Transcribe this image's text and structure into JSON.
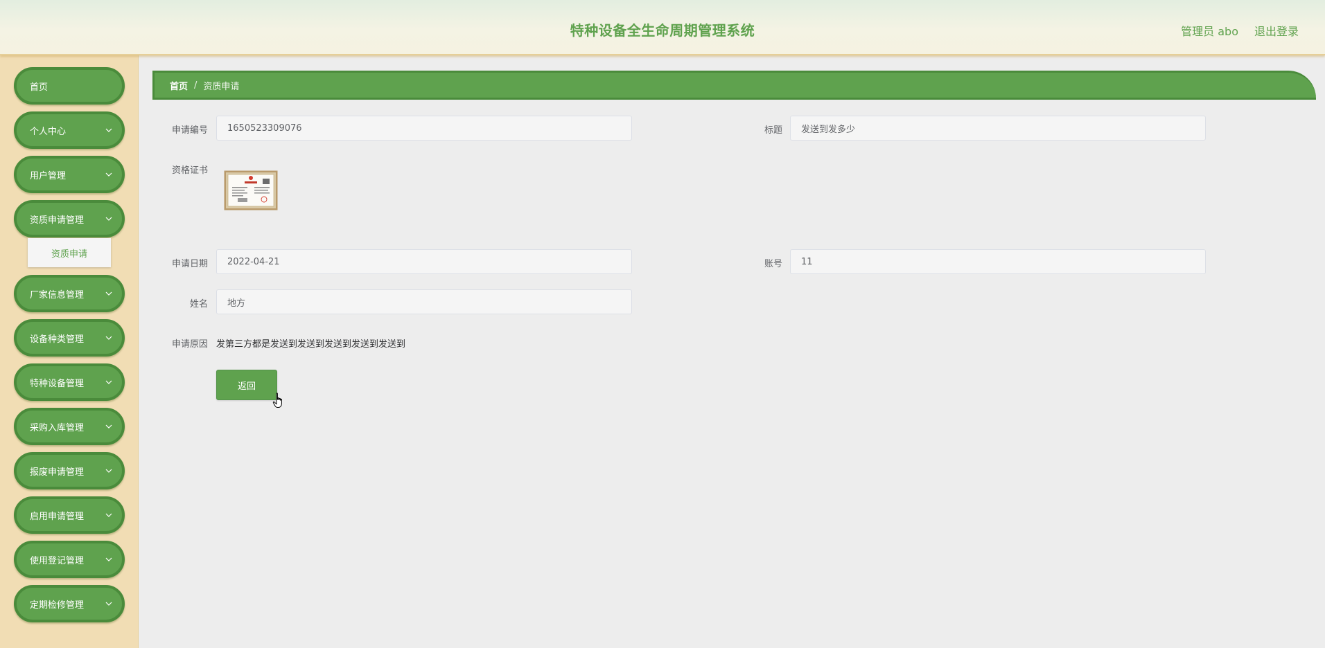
{
  "header": {
    "title": "特种设备全生命周期管理系统",
    "user": "管理员 abo",
    "logout": "退出登录"
  },
  "sidebar": {
    "items": [
      {
        "label": "首页",
        "has_children": false
      },
      {
        "label": "个人中心",
        "has_children": true
      },
      {
        "label": "用户管理",
        "has_children": true
      },
      {
        "label": "资质申请管理",
        "has_children": true,
        "expanded": true
      },
      {
        "label": "厂家信息管理",
        "has_children": true
      },
      {
        "label": "设备种类管理",
        "has_children": true
      },
      {
        "label": "特种设备管理",
        "has_children": true
      },
      {
        "label": "采购入库管理",
        "has_children": true
      },
      {
        "label": "报废申请管理",
        "has_children": true
      },
      {
        "label": "启用申请管理",
        "has_children": true
      },
      {
        "label": "使用登记管理",
        "has_children": true
      },
      {
        "label": "定期检修管理",
        "has_children": true
      }
    ],
    "submenu": {
      "label": "资质申请"
    }
  },
  "breadcrumb": {
    "home": "首页",
    "separator": "/",
    "current": "资质申请"
  },
  "form": {
    "apply_no_label": "申请编号",
    "apply_no_value": "1650523309076",
    "title_label": "标题",
    "title_value": "发送到发多少",
    "cert_label": "资格证书",
    "cert_image": "certificate-thumbnail",
    "date_label": "申请日期",
    "date_value": "2022-04-21",
    "account_label": "账号",
    "account_value": "11",
    "name_label": "姓名",
    "name_value": "地方",
    "reason_label": "申请原因",
    "reason_value": "发第三方都是发送到发送到发送到发送到发送到",
    "back_button": "返回"
  },
  "colors": {
    "accent": "#5fa24e",
    "accent_dark": "#4a8b3b",
    "sidebar_bg": "#f1ddb4",
    "content_bg": "#ededed"
  }
}
